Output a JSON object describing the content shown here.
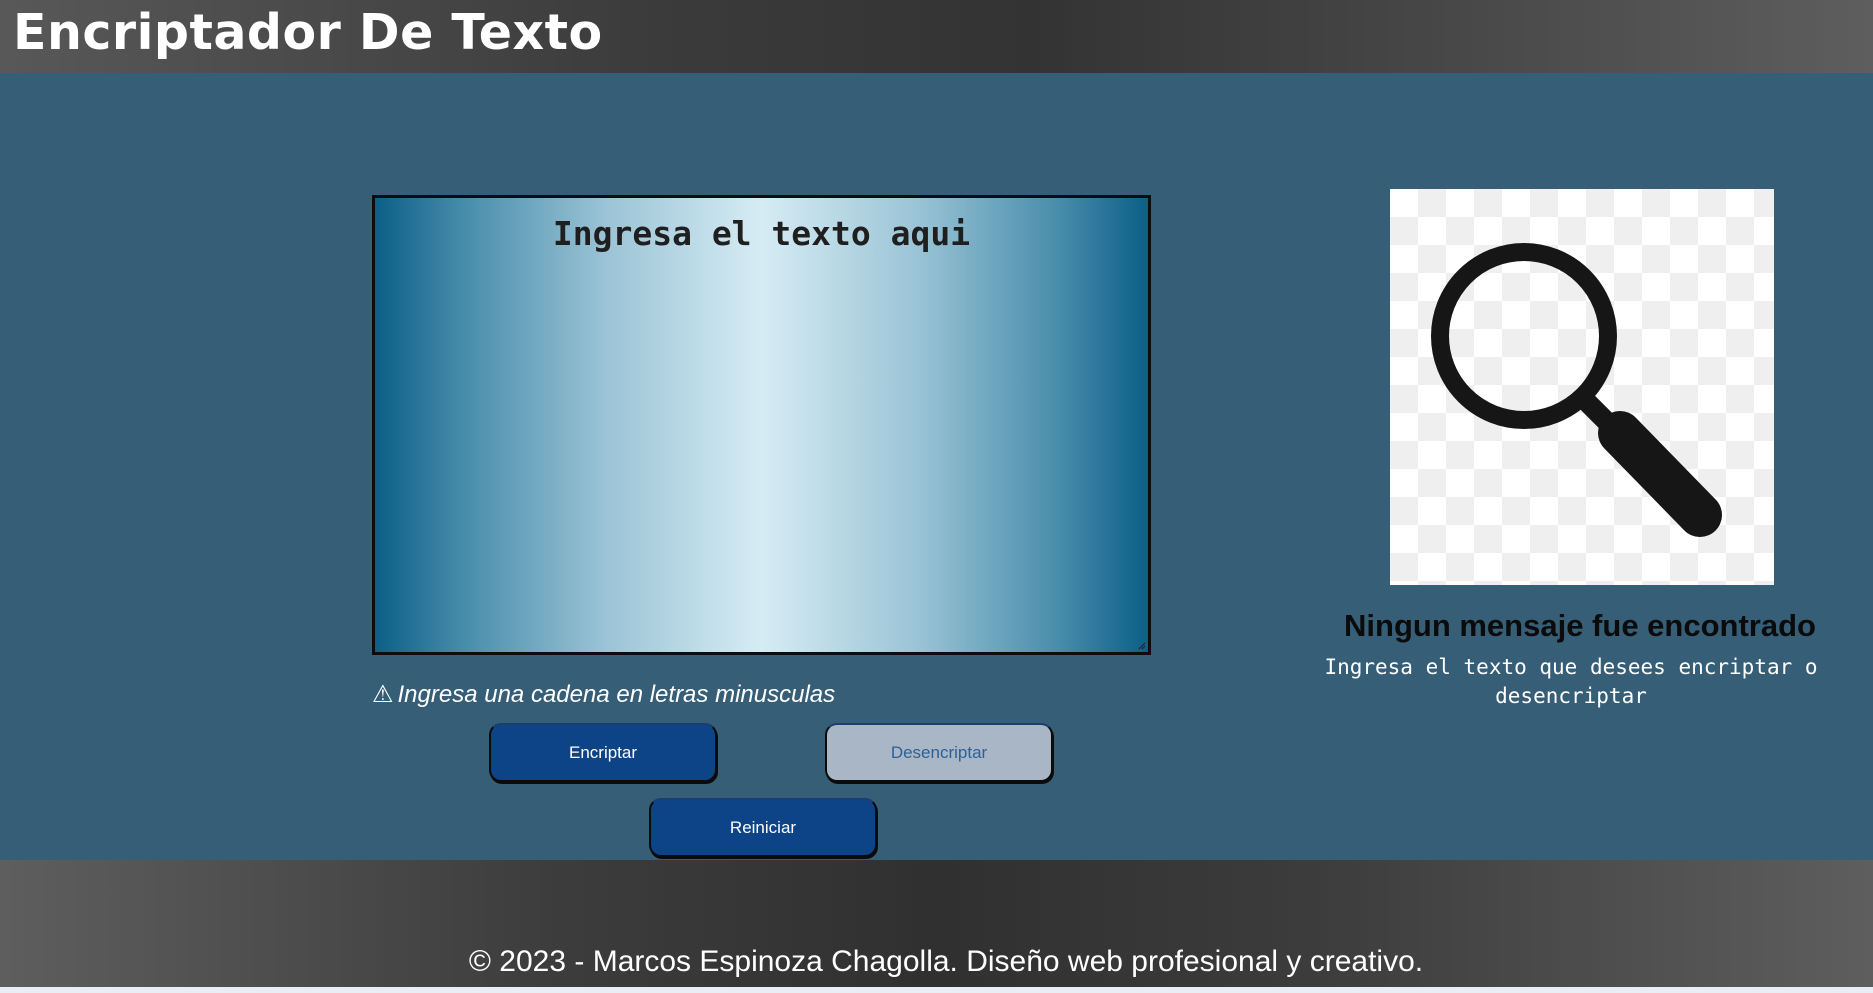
{
  "header": {
    "title": "Encriptador De Texto"
  },
  "input": {
    "placeholder": "Ingresa el texto aqui",
    "value": ""
  },
  "warning": {
    "icon": "warning-triangle-icon",
    "glyph": "⚠",
    "text": "Ingresa una cadena en letras minusculas"
  },
  "buttons": {
    "encrypt_label": "Encriptar",
    "decrypt_label": "Desencriptar",
    "reset_label": "Reiniciar"
  },
  "result": {
    "illustration_icon": "magnifying-glass-icon",
    "title": "Ningun mensaje fue encontrado",
    "text": "Ingresa el texto que desees encriptar o desencriptar"
  },
  "footer": {
    "text": "© 2023 - Marcos Espinoza Chagolla. Diseño web profesional y creativo."
  },
  "colors": {
    "header_bg": "#3b3b3b",
    "main_bg": "#365e77",
    "primary_button": "#0d4488",
    "secondary_button": "#a9b6c6",
    "secondary_button_text": "#2f5f99"
  }
}
